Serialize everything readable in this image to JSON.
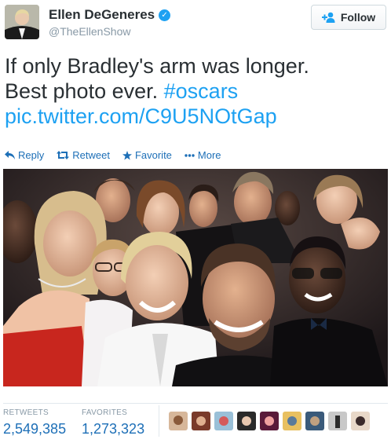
{
  "user": {
    "display_name": "Ellen DeGeneres",
    "verified": true,
    "handle": "@TheEllenShow"
  },
  "follow_label": "Follow",
  "tweet": {
    "line1": "If only Bradley's arm was longer.",
    "line2": "Best photo ever. ",
    "hashtag": "#oscars",
    "link": "pic.twitter.com/C9U5NOtGap"
  },
  "actions": [
    {
      "label": "Reply",
      "icon": "reply-icon"
    },
    {
      "label": "Retweet",
      "icon": "retweet-icon"
    },
    {
      "label": "Favorite",
      "icon": "star-icon"
    },
    {
      "label": "More",
      "icon": "more-icon"
    }
  ],
  "stats": {
    "retweets_label": "RETWEETS",
    "retweets_value": "2,549,385",
    "favorites_label": "FAVORITES",
    "favorites_value": "1,273,323"
  },
  "colors": {
    "link": "#1da1f2",
    "action": "#1d6fb7",
    "text": "#292f33",
    "muted": "#8899a6"
  },
  "favoriter_avatars": [
    "avatar-1",
    "avatar-2",
    "avatar-3",
    "avatar-4",
    "avatar-5",
    "avatar-6",
    "avatar-7",
    "avatar-8",
    "avatar-9"
  ]
}
